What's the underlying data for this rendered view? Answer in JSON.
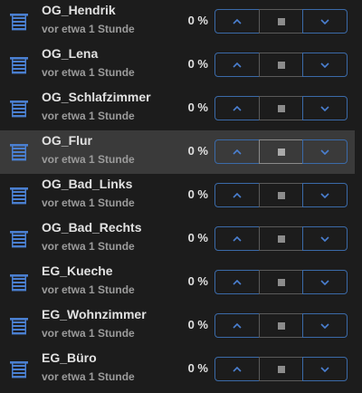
{
  "colors": {
    "background": "#1c1c1c",
    "row_hover": "#3a3a3a",
    "icon_blue": "#4a7fd0",
    "button_border_blue": "#3b6aa8",
    "text_primary": "#e1e1e1",
    "text_secondary": "#9b9b9b"
  },
  "icons": {
    "entity": "window-shutter-icon",
    "open": "chevron-up-icon",
    "stop": "stop-square-icon",
    "close": "chevron-down-icon"
  },
  "hovered_row": "OG_Flur",
  "covers": [
    {
      "name": "OG_Hendrik",
      "last_changed": "vor etwa 1 Stunde",
      "position": "0 %"
    },
    {
      "name": "OG_Lena",
      "last_changed": "vor etwa 1 Stunde",
      "position": "0 %"
    },
    {
      "name": "OG_Schlafzimmer",
      "last_changed": "vor etwa 1 Stunde",
      "position": "0 %"
    },
    {
      "name": "OG_Flur",
      "last_changed": "vor etwa 1 Stunde",
      "position": "0 %"
    },
    {
      "name": "OG_Bad_Links",
      "last_changed": "vor etwa 1 Stunde",
      "position": "0 %"
    },
    {
      "name": "OG_Bad_Rechts",
      "last_changed": "vor etwa 1 Stunde",
      "position": "0 %"
    },
    {
      "name": "EG_Kueche",
      "last_changed": "vor etwa 1 Stunde",
      "position": "0 %"
    },
    {
      "name": "EG_Wohnzimmer",
      "last_changed": "vor etwa 1 Stunde",
      "position": "0 %"
    },
    {
      "name": "EG_Büro",
      "last_changed": "vor etwa 1 Stunde",
      "position": "0 %"
    }
  ]
}
